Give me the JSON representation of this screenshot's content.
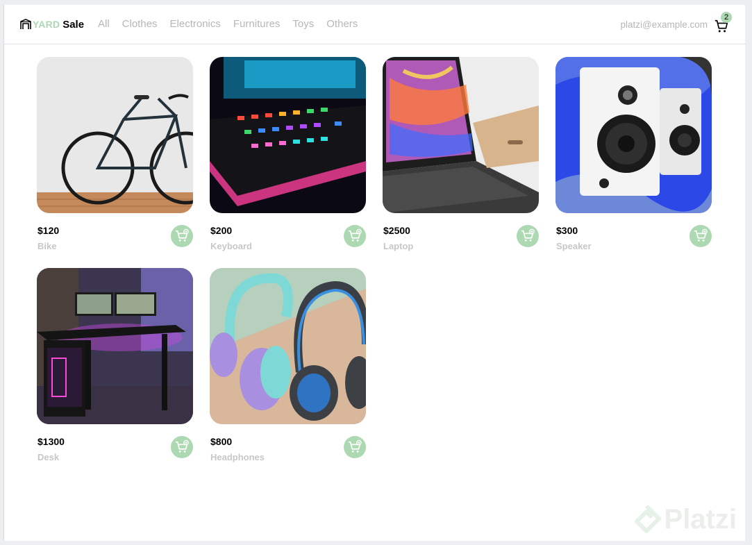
{
  "brand": {
    "yard": "YARD",
    "sale": "Sale"
  },
  "nav": {
    "items": [
      "All",
      "Clothes",
      "Electronics",
      "Furnitures",
      "Toys",
      "Others"
    ]
  },
  "account": {
    "email": "platzi@example.com"
  },
  "cart": {
    "count": "2"
  },
  "products": [
    {
      "price": "$120",
      "name": "Bike"
    },
    {
      "price": "$200",
      "name": "Keyboard"
    },
    {
      "price": "$2500",
      "name": "Laptop"
    },
    {
      "price": "$300",
      "name": "Speaker"
    },
    {
      "price": "$1300",
      "name": "Desk"
    },
    {
      "price": "$800",
      "name": "Headphones"
    }
  ],
  "watermark": {
    "text": "Platzi"
  },
  "colors": {
    "accent": "#acd9b2",
    "muted_text": "#b7b7b7"
  }
}
